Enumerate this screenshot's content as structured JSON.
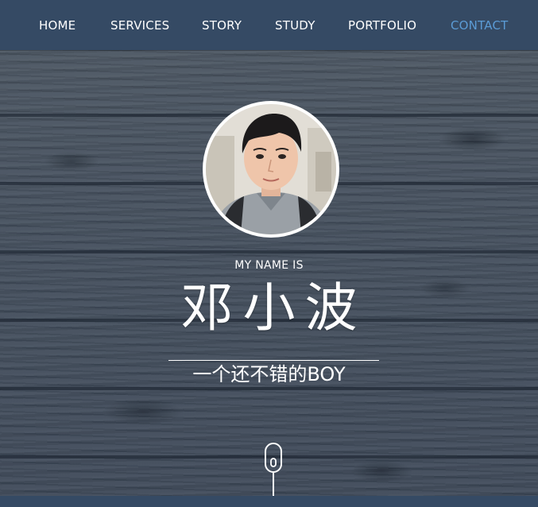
{
  "nav": {
    "items": [
      {
        "label": "HOME"
      },
      {
        "label": "SERVICES"
      },
      {
        "label": "STORY"
      },
      {
        "label": "STUDY"
      },
      {
        "label": "PORTFOLIO"
      },
      {
        "label": "CONTACT"
      }
    ],
    "active_index": 5
  },
  "hero": {
    "eyebrow": "MY NAME IS",
    "name": "邓小波",
    "tagline": "一个还不错的BOY",
    "scroll_icon": "mouse-scroll-icon"
  },
  "colors": {
    "nav_bg": "#354a64",
    "nav_text": "#ffffff",
    "nav_active": "#5b9bd5",
    "hero_text": "#ffffff"
  }
}
